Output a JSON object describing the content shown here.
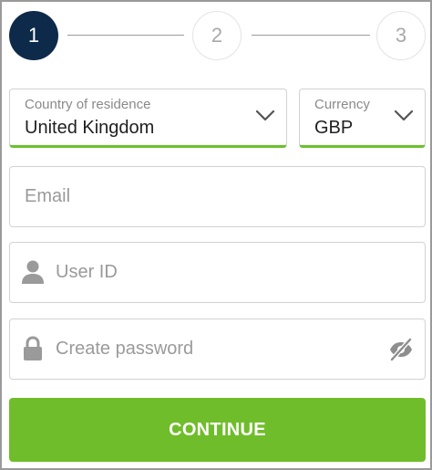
{
  "stepper": {
    "steps": [
      {
        "label": "1",
        "state": "active"
      },
      {
        "label": "2",
        "state": "inactive"
      },
      {
        "label": "3",
        "state": "inactive"
      }
    ]
  },
  "form": {
    "country": {
      "label": "Country of residence",
      "value": "United Kingdom"
    },
    "currency": {
      "label": "Currency",
      "value": "GBP"
    },
    "email": {
      "placeholder": "Email"
    },
    "user_id": {
      "placeholder": "User ID"
    },
    "password": {
      "placeholder": "Create password"
    },
    "continue_label": "CONTINUE"
  },
  "colors": {
    "active_step": "#0e2a4a",
    "accent_green": "#6fbd2b",
    "placeholder_gray": "#9a9a9a"
  },
  "icons": {
    "select_chevron": "chevron-down-icon",
    "user_id": "user-icon",
    "password": "lock-icon",
    "password_toggle": "eye-off-icon"
  }
}
